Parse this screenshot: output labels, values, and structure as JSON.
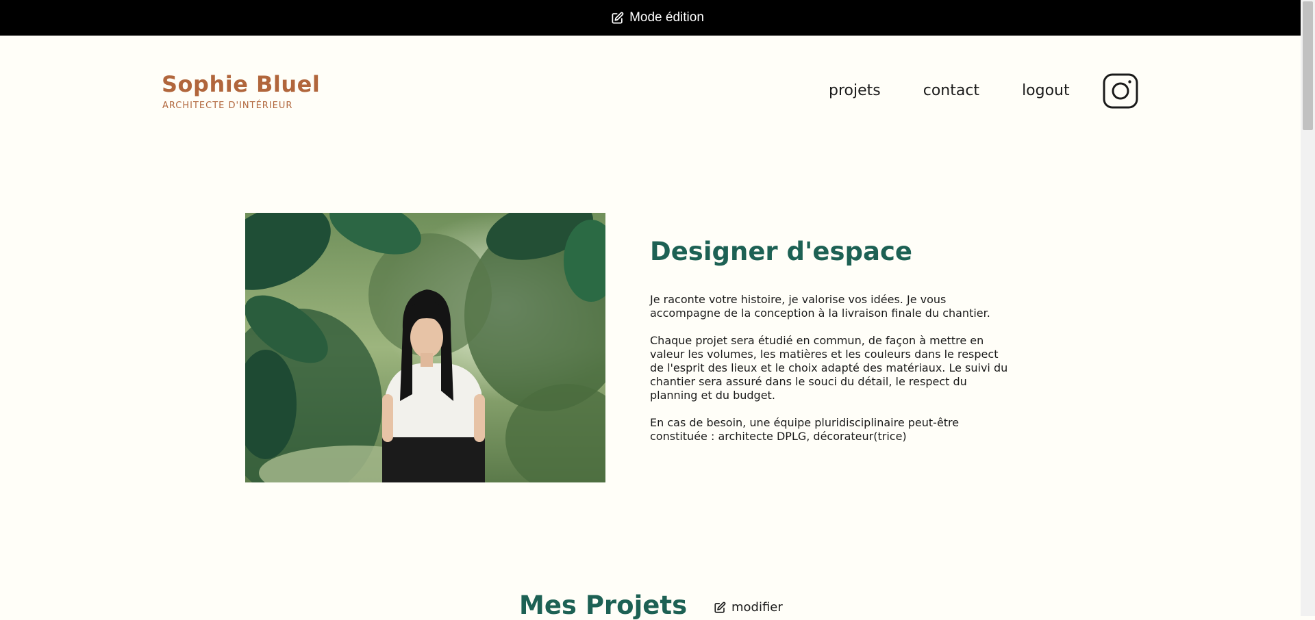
{
  "edit_banner": {
    "icon": "edit-icon",
    "label": "Mode édition"
  },
  "header": {
    "brand_title": "Sophie Bluel",
    "brand_subtitle": "ARCHITECTE D'INTÉRIEUR",
    "nav": [
      {
        "label": "projets"
      },
      {
        "label": "contact"
      },
      {
        "label": "logout"
      }
    ],
    "social_icon": "instagram-icon"
  },
  "intro": {
    "image": "portrait of woman in white top among green foliage",
    "title": "Designer d'espace",
    "paragraphs": [
      "Je raconte votre histoire, je valorise vos idées. Je vous accompagne de la conception à la livraison finale du chantier.",
      "Chaque projet sera étudié en commun, de façon à mettre en valeur les volumes, les matières et les couleurs dans le respect de l'esprit des lieux et le choix adapté des matériaux. Le suivi du chantier sera assuré dans le souci du détail, le respect du planning et du budget.",
      "En cas de besoin, une équipe pluridisciplinaire peut-être constituée : architecte DPLG, décorateur(trice)"
    ]
  },
  "projects": {
    "title": "Mes Projets",
    "modify_label": "modifier",
    "modify_icon": "edit-icon"
  },
  "colors": {
    "background": "#FFFEF8",
    "brand": "#B1663C",
    "accent": "#1D6154",
    "banner": "#000000"
  }
}
